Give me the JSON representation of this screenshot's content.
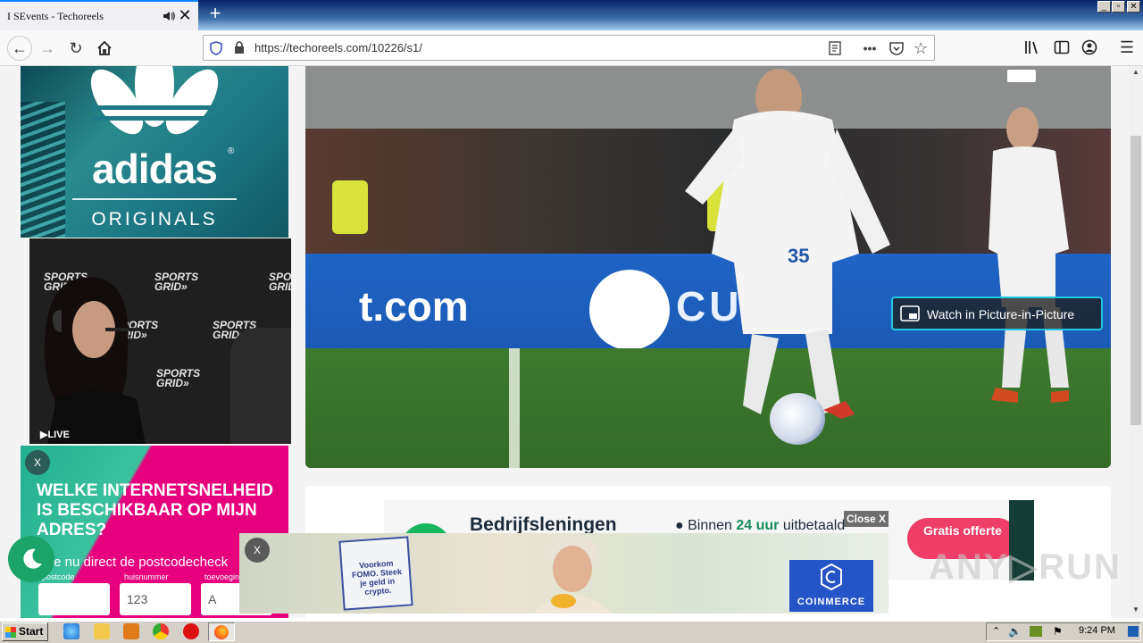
{
  "browser": {
    "tab_title": "I SEvents - Techoreels",
    "tab_close": "✕",
    "new_tab": "+",
    "url": "https://techoreels.com/10226/s1/",
    "window_controls": [
      "_",
      "▫",
      "✕"
    ]
  },
  "page": {
    "ad_adidas": {
      "word": "adidas",
      "sub": "ORIGINALS",
      "reg": "®"
    },
    "stream": {
      "brand_lines": [
        "SPORTS",
        "GRID»"
      ],
      "live": "▶LIVE"
    },
    "ad_kpn": {
      "close": "X",
      "headline": "WELKE INTERNETSNELHEID IS BESCHIKBAAR OP MIJN ADRES?",
      "subline": "Doe nu direct de postcodecheck",
      "labels": [
        "postcode",
        "huisnummer",
        "toevoeging"
      ],
      "values": [
        "",
        "123",
        "A"
      ]
    },
    "video": {
      "banner_left": "t.com",
      "banner_right": "CUVEE",
      "jersey_number": "35",
      "pip_label": "Watch in Picture-in-Picture"
    },
    "ad_loans": {
      "title": "Bedrijfsleningen",
      "sub_prefix": "● Binnen",
      "sub_highlight": "24 uur",
      "sub_suffix": "uitbetaald",
      "cta": "Gratis offerte"
    },
    "close_ad": "Close X",
    "ad_coinmerce": {
      "close": "X",
      "tile_text": "Voorkom FOMO. Steek je geld in crypto.",
      "brand": "COINMERCE"
    },
    "watermark": "ANY▷RUN"
  },
  "taskbar": {
    "start": "Start",
    "clock": "9:24 PM"
  },
  "colors": {
    "accent": "#0a84ff",
    "kpn_green": "#21b08f",
    "kpn_pink": "#e6007e",
    "pip_border": "#22c5e6",
    "moon_green": "#1ba36a"
  }
}
